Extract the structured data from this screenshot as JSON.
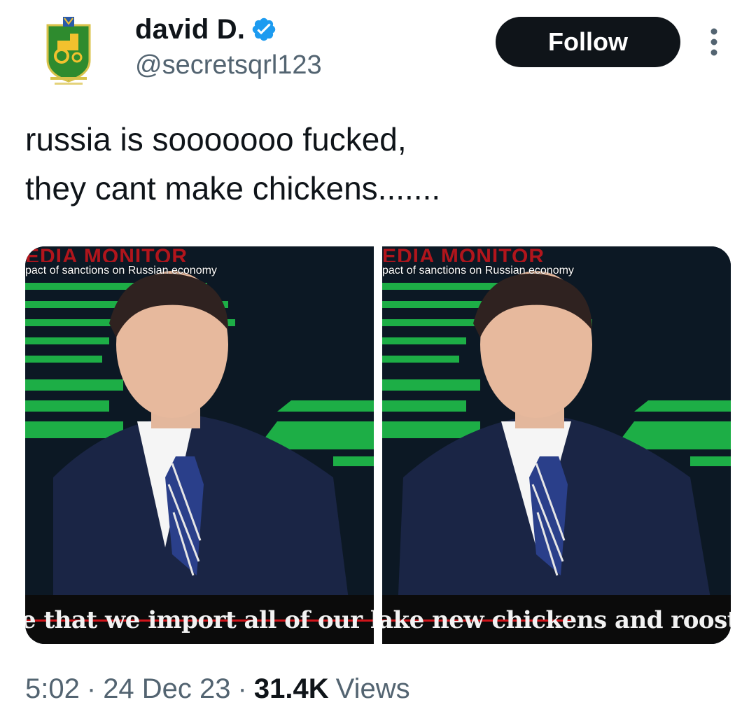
{
  "author": {
    "display_name": "david D.",
    "handle": "@secretsqrl123",
    "verified": true,
    "avatar_icon": "crest-tractor-icon"
  },
  "actions": {
    "follow_label": "Follow",
    "more_icon": "more-vertical-icon"
  },
  "tweet": {
    "text_lines": [
      "russia is sooooooo fucked,",
      "they cant make chickens......."
    ]
  },
  "media": [
    {
      "monitor_title": "EDIA MONITOR",
      "top_caption": "pact of sanctions on Russian economy",
      "subtitle": "e that we import all of our ha"
    },
    {
      "monitor_title": "EDIA MONITOR",
      "top_caption": "pact of sanctions on Russian economy",
      "subtitle": "ake new chickens and roost"
    }
  ],
  "meta": {
    "time": "5:02",
    "date": "24 Dec 23",
    "separator": "·",
    "views_count": "31.4K",
    "views_label": "Views"
  },
  "colors": {
    "text_primary": "#0f1419",
    "text_secondary": "#536471",
    "verified_blue": "#1d9bf0",
    "follow_bg": "#0f1419",
    "broadcast_green": "#1fbf4a",
    "subtitle_red": "#d0141a"
  }
}
